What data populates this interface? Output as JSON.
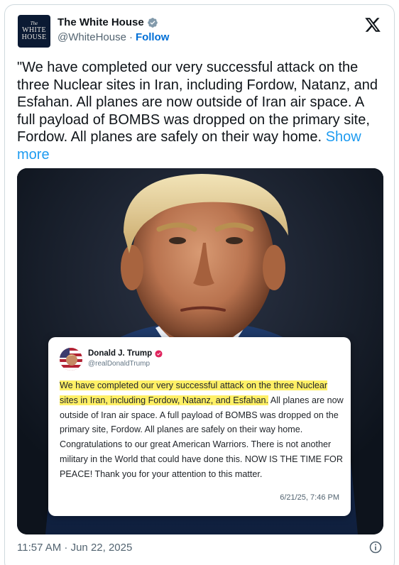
{
  "author": {
    "avatar_lines": [
      "The",
      "WHITE",
      "HOUSE"
    ],
    "display_name": "The White House",
    "handle": "@WhiteHouse",
    "separator": "·",
    "follow_label": "Follow",
    "verified_icon": "verified-badge-icon"
  },
  "tweet": {
    "text": "\"We have completed our very successful attack on the three Nuclear sites in Iran, including Fordow, Natanz, and Esfahan. All planes are now outside of Iran air space. A full payload of BOMBS was dropped on the primary site, Fordow. All planes are safely on their way home.",
    "show_more": "Show more"
  },
  "embedded_post": {
    "name": "Donald J. Trump",
    "handle": "@realDonaldTrump",
    "highlighted_text": "We have completed our very successful attack on the three Nuclear sites in Iran, including Fordow, Natanz, and Esfahan.",
    "body_text": "All planes are now outside of Iran air space. A full payload of BOMBS was dropped on the primary site, Fordow. All planes are safely on their way home. Congratulations to our great American Warriors. There is not another military in the World that could have done this. NOW IS THE TIME FOR PEACE! Thank you for your attention to this matter.",
    "date": "6/21/25, 7:46 PM",
    "highlight_color": "#fff066"
  },
  "footer": {
    "timestamp": "11:57 AM · Jun 22, 2025",
    "info_icon": "info-icon"
  },
  "colors": {
    "link": "#1d9bf0",
    "follow": "#006fd6",
    "verified_blue": "#1d9bf0",
    "truth_badge": "#e0245e"
  }
}
